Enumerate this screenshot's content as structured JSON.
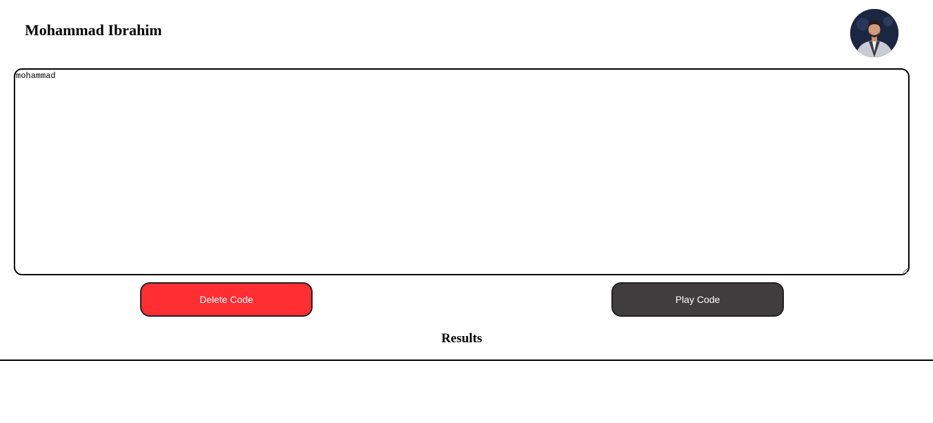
{
  "header": {
    "title": "Mohammad Ibrahim"
  },
  "editor": {
    "value": "mohammad"
  },
  "actions": {
    "delete_label": "Delete Code",
    "play_label": "Play Code"
  },
  "results": {
    "title": "Results",
    "output": ""
  },
  "colors": {
    "delete_button": "#ff2e32",
    "play_button": "#3f3d3e"
  }
}
